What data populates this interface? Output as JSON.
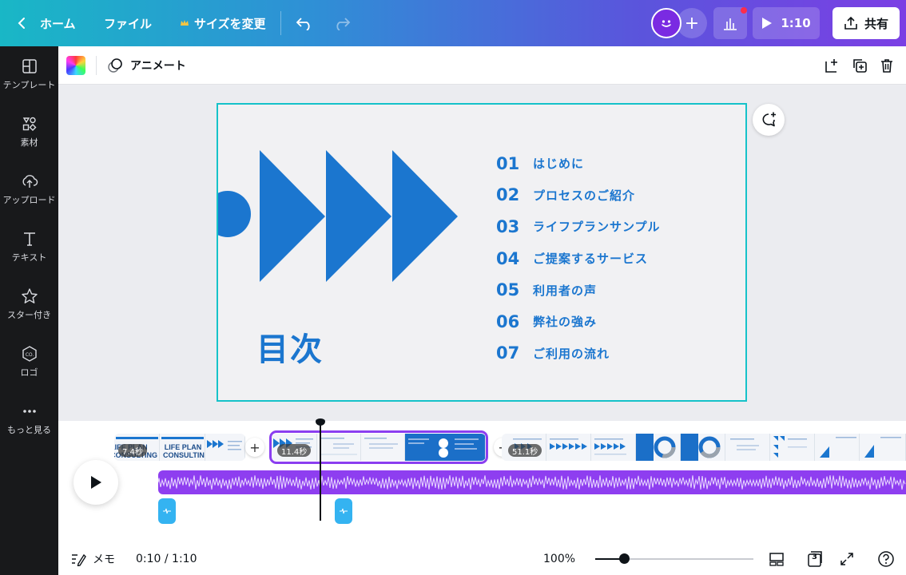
{
  "topbar": {
    "home_label": "ホーム",
    "file_label": "ファイル",
    "resize_label": "サイズを変更",
    "duration": "1:10",
    "share_label": "共有"
  },
  "sidebar": {
    "items": [
      {
        "label": "テンプレート",
        "icon": "template-icon"
      },
      {
        "label": "素材",
        "icon": "elements-icon"
      },
      {
        "label": "アップロード",
        "icon": "upload-icon"
      },
      {
        "label": "テキスト",
        "icon": "text-icon"
      },
      {
        "label": "スター付き",
        "icon": "star-icon"
      },
      {
        "label": "ロゴ",
        "icon": "logo-icon"
      },
      {
        "label": "もっと見る",
        "icon": "more-icon"
      }
    ]
  },
  "toolbar": {
    "animate_label": "アニメート"
  },
  "slide": {
    "title": "目次",
    "toc": [
      {
        "num": "01",
        "label": "はじめに"
      },
      {
        "num": "02",
        "label": "プロセスのご紹介"
      },
      {
        "num": "03",
        "label": "ライフプランサンプル"
      },
      {
        "num": "04",
        "label": "ご提案するサービス"
      },
      {
        "num": "05",
        "label": "利用者の声"
      },
      {
        "num": "06",
        "label": "弊社の強み"
      },
      {
        "num": "07",
        "label": "ご利用の流れ"
      }
    ],
    "colors": {
      "accent": "#1b76cf",
      "border": "#15c2c9",
      "background": "#f1f1f3"
    }
  },
  "timeline": {
    "clips": [
      {
        "duration": "7.4秒",
        "thumb_text_1": "LIFE PLAN CONSULTING",
        "thumb_text_2": "LIFE PLAN CONSULTING"
      },
      {
        "duration": "11.4秒"
      },
      {
        "duration": "51.1秒"
      }
    ],
    "selected_color": "#8b3ef0",
    "audio_color": "#8e3ef0"
  },
  "bottombar": {
    "notes_label": "メモ",
    "time": "0:10 / 1:10",
    "zoom": "100%",
    "zoom_fraction": 0.18,
    "page_count": "3"
  }
}
